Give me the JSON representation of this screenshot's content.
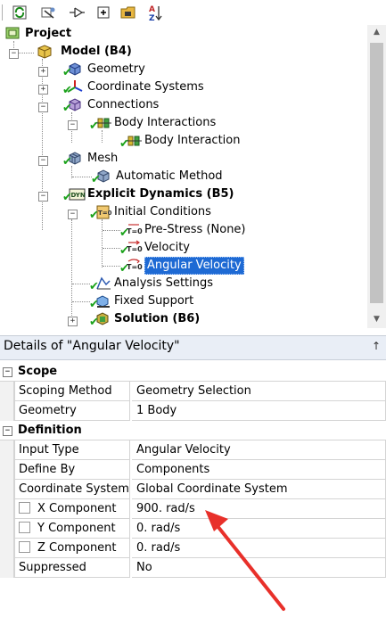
{
  "toolbar": {
    "icons": [
      "refresh-icon",
      "tree-view-icon",
      "node-graph-icon",
      "expand-all-icon",
      "folder-icon",
      "sort-az-icon"
    ]
  },
  "tree": {
    "project": "Project",
    "model": "Model (B4)",
    "geometry": "Geometry",
    "coordinate_systems": "Coordinate Systems",
    "connections": "Connections",
    "body_interactions": "Body Interactions",
    "body_interaction": "Body Interaction",
    "mesh": "Mesh",
    "automatic_method": "Automatic Method",
    "explicit_dynamics": "Explicit Dynamics (B5)",
    "initial_conditions": "Initial Conditions",
    "pre_stress": "Pre-Stress (None)",
    "velocity": "Velocity",
    "angular_velocity": "Angular Velocity",
    "analysis_settings": "Analysis Settings",
    "fixed_support": "Fixed Support",
    "solution": "Solution (B6)"
  },
  "details": {
    "title": "Details of \"Angular Velocity\"",
    "pin": "↑",
    "scope_header": "Scope",
    "definition_header": "Definition",
    "rows": {
      "scoping_method": {
        "label": "Scoping Method",
        "value": "Geometry Selection"
      },
      "geometry": {
        "label": "Geometry",
        "value": "1 Body"
      },
      "input_type": {
        "label": "Input Type",
        "value": "Angular Velocity"
      },
      "define_by": {
        "label": "Define By",
        "value": "Components"
      },
      "coordinate_system": {
        "label": "Coordinate System",
        "value": "Global Coordinate System"
      },
      "x_component": {
        "label": "X Component",
        "value": "900. rad/s"
      },
      "y_component": {
        "label": "Y Component",
        "value": "0. rad/s"
      },
      "z_component": {
        "label": "Z Component",
        "value": "0. rad/s"
      },
      "suppressed": {
        "label": "Suppressed",
        "value": "No"
      }
    }
  },
  "colors": {
    "selection": "#1e6ad4",
    "check": "#1aa21a",
    "annotation_arrow": "#e8302a",
    "header_bg": "#e9eef6"
  }
}
